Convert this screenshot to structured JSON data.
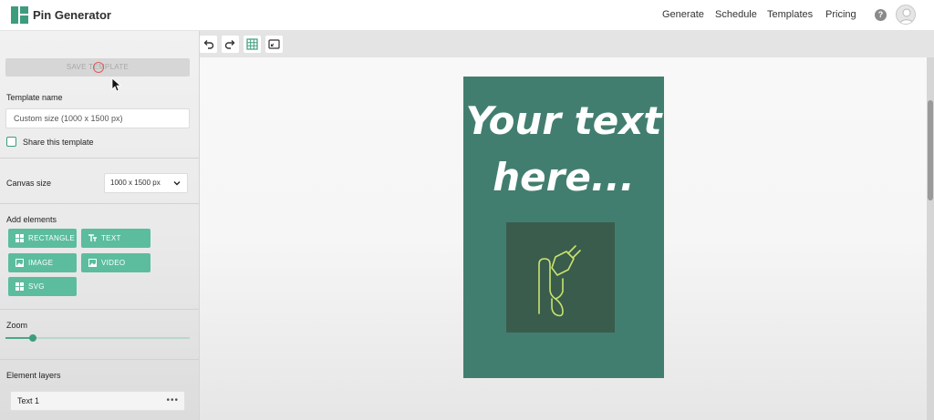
{
  "app": {
    "title": "Pin Generator"
  },
  "nav": {
    "items": [
      "Generate",
      "Schedule",
      "Templates",
      "Pricing"
    ],
    "help": "?"
  },
  "sidebar": {
    "save_label": "SAVE TEMPLATE",
    "template_name_label": "Template name",
    "template_name_value": "Custom size (1000 x 1500 px)",
    "share_label": "Share this template",
    "canvas_size_label": "Canvas size",
    "canvas_size_value": "1000 x 1500 px",
    "add_elements_label": "Add elements",
    "elements": {
      "rectangle": "RECTANGLE",
      "text": "TEXT",
      "image": "IMAGE",
      "video": "VIDEO",
      "svg": "SVG"
    },
    "zoom_label": "Zoom",
    "zoom_level": 0.15,
    "layers_label": "Element layers",
    "layers": [
      "Text 1"
    ],
    "layer_menu": "•••"
  },
  "canvas": {
    "text_line1": "Your text",
    "text_line2": "here...",
    "icon": "plug-icon"
  },
  "colors": {
    "accent": "#3e9c7e",
    "button": "#5bbd9e",
    "pin_background": "#427e6f",
    "image_background": "#3a5c4c",
    "icon_stroke": "#c9e36f"
  }
}
